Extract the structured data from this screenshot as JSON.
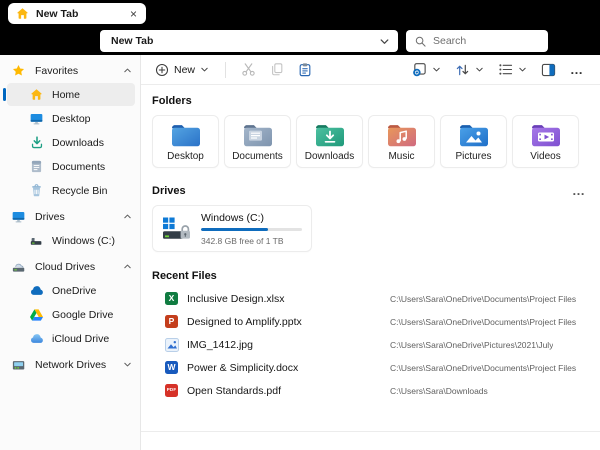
{
  "colors": {
    "titlebar": "#000000",
    "accent": "#0067c0",
    "progress": "#0f6cbd",
    "selection": "#ededed"
  },
  "titlebar": {
    "tab": {
      "label": "New Tab",
      "icon": "home-icon",
      "close_glyph": "×"
    }
  },
  "addressbar": {
    "value": "New Tab",
    "dropdown_icon": "chevron-down-icon",
    "search_icon": "search-icon",
    "search_placeholder": "Search"
  },
  "toolbar": {
    "new_label": "New",
    "more_glyph": "…",
    "icons": [
      "new-plus-icon",
      "chevron-down-icon",
      "cut-icon",
      "copy-icon",
      "paste-icon",
      "sync-status-icon",
      "sort-icon",
      "view-options-icon",
      "details-pane-icon",
      "more-icon"
    ]
  },
  "sidebar": {
    "sections": [
      {
        "label": "Favorites",
        "icon": "star-icon",
        "expanded": true,
        "items": [
          {
            "label": "Home",
            "icon": "home-icon",
            "selected": true
          },
          {
            "label": "Desktop",
            "icon": "desktop-icon",
            "selected": false
          },
          {
            "label": "Downloads",
            "icon": "downloads-icon",
            "selected": false
          },
          {
            "label": "Documents",
            "icon": "documents-icon",
            "selected": false
          },
          {
            "label": "Recycle Bin",
            "icon": "recycle-bin-icon",
            "selected": false
          }
        ]
      },
      {
        "label": "Drives",
        "icon": "monitor-icon",
        "expanded": true,
        "items": [
          {
            "label": "Windows (C:)",
            "icon": "hard-drive-icon",
            "selected": false
          }
        ]
      },
      {
        "label": "Cloud Drives",
        "icon": "cloud-drive-icon",
        "expanded": true,
        "items": [
          {
            "label": "OneDrive",
            "icon": "onedrive-icon",
            "selected": false
          },
          {
            "label": "Google Drive",
            "icon": "google-drive-icon",
            "selected": false
          },
          {
            "label": "iCloud Drive",
            "icon": "icloud-icon",
            "selected": false
          }
        ]
      },
      {
        "label": "Network Drives",
        "icon": "network-drive-icon",
        "expanded": false,
        "items": []
      }
    ]
  },
  "main": {
    "folders_section": {
      "title": "Folders",
      "items": [
        {
          "label": "Desktop",
          "icon": "desktop-folder-icon"
        },
        {
          "label": "Documents",
          "icon": "documents-folder-icon"
        },
        {
          "label": "Downloads",
          "icon": "downloads-folder-icon"
        },
        {
          "label": "Music",
          "icon": "music-folder-icon"
        },
        {
          "label": "Pictures",
          "icon": "pictures-folder-icon"
        },
        {
          "label": "Videos",
          "icon": "videos-folder-icon"
        }
      ]
    },
    "drives_section": {
      "title": "Drives",
      "more_glyph": "…",
      "items": [
        {
          "label": "Windows (C:)",
          "icon": "windows-bitlocker-drive-icon",
          "usage": "342.8 GB free of 1 TB",
          "percent_used": 66
        }
      ]
    },
    "recent_section": {
      "title": "Recent Files",
      "files": [
        {
          "name": "Inclusive Design.xlsx",
          "path": "C:\\Users\\Sara\\OneDrive\\Documents\\Project Files",
          "icon": "excel-icon",
          "badge": "X"
        },
        {
          "name": "Designed to Amplify.pptx",
          "path": "C:\\Users\\Sara\\OneDrive\\Documents\\Project Files",
          "icon": "powerpoint-icon",
          "badge": "P"
        },
        {
          "name": "IMG_1412.jpg",
          "path": "C:\\Users\\Sara\\OneDrive\\Pictures\\2021\\July",
          "icon": "image-icon",
          "badge": ""
        },
        {
          "name": "Power & Simplicity.docx",
          "path": "C:\\Users\\Sara\\OneDrive\\Documents\\Project Files",
          "icon": "word-icon",
          "badge": "W"
        },
        {
          "name": "Open Standards.pdf",
          "path": "C:\\Users\\Sara\\Downloads",
          "icon": "pdf-icon",
          "badge": "PDF"
        }
      ]
    }
  }
}
